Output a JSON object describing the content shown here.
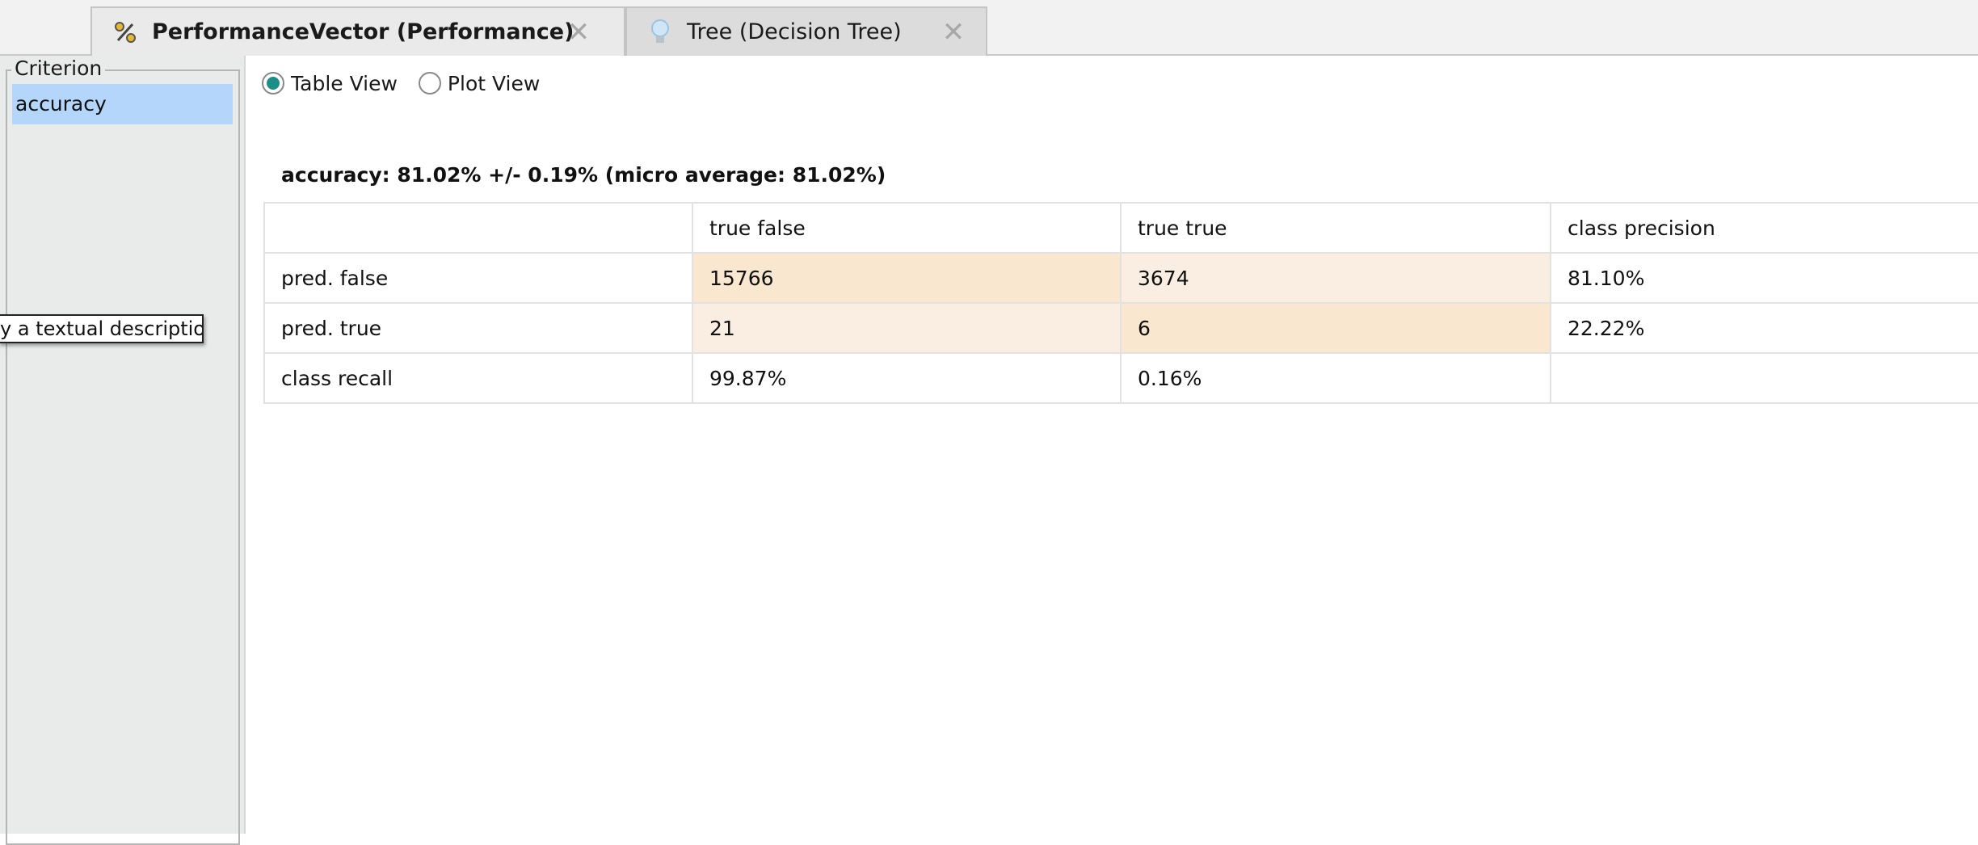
{
  "tabs": [
    {
      "label": "PerformanceVector (Performance)",
      "icon": "percent-icon",
      "active": true
    },
    {
      "label": "Tree (Decision Tree)",
      "icon": "lightbulb-icon",
      "active": false
    }
  ],
  "left_panel": {
    "legend": "Criterion",
    "items": [
      "accuracy"
    ],
    "tooltip": "y a textual description"
  },
  "view_toggle": {
    "table_label": "Table View",
    "plot_label": "Plot View",
    "selected": "Table View"
  },
  "summary": "accuracy: 81.02% +/- 0.19% (micro average: 81.02%)",
  "matrix": {
    "header": [
      "",
      "true false",
      "true true",
      "class precision"
    ],
    "rows": [
      [
        "pred. false",
        "15766",
        "3674",
        "81.10%"
      ],
      [
        "pred. true",
        "21",
        "6",
        "22.22%"
      ],
      [
        "class recall",
        "99.87%",
        "0.16%",
        ""
      ]
    ]
  },
  "colors": {
    "accent": "#1b8f87",
    "selection": "#b4d6fa",
    "cell_high": "#fae7cf",
    "cell_low": "#f9eee1"
  }
}
